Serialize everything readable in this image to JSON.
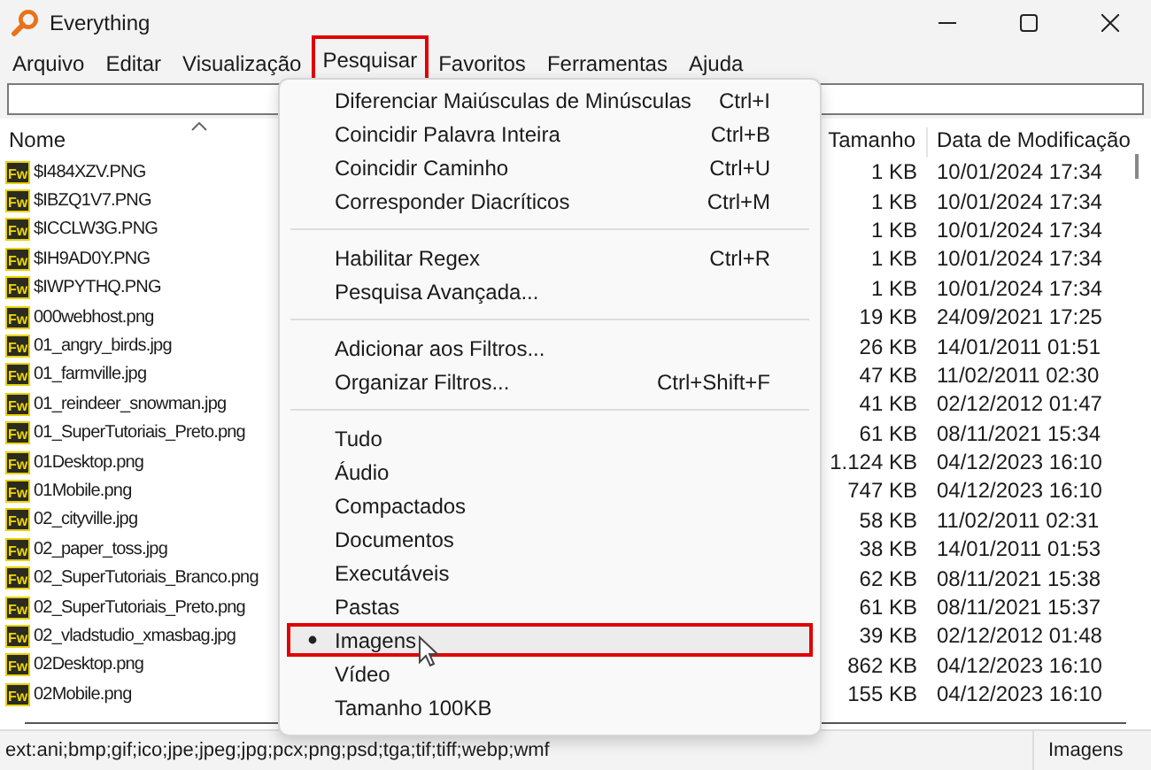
{
  "window": {
    "title": "Everything"
  },
  "menubar": [
    {
      "label": "Arquivo",
      "highlighted": false
    },
    {
      "label": "Editar",
      "highlighted": false
    },
    {
      "label": "Visualização",
      "highlighted": false
    },
    {
      "label": "Pesquisar",
      "highlighted": true
    },
    {
      "label": "Favoritos",
      "highlighted": false
    },
    {
      "label": "Ferramentas",
      "highlighted": false
    },
    {
      "label": "Ajuda",
      "highlighted": false
    }
  ],
  "search": {
    "kind": "empty"
  },
  "table": {
    "columns": [
      "Nome",
      "Tamanho",
      "Data de Modificação"
    ],
    "rows": [
      {
        "icon_text": "Fw",
        "name": "$I484XZV.PNG",
        "size": "1 KB",
        "date": "10/01/2024 17:34"
      },
      {
        "icon_text": "Fw",
        "name": "$IBZQ1V7.PNG",
        "size": "1 KB",
        "date": "10/01/2024 17:34"
      },
      {
        "icon_text": "Fw",
        "name": "$ICCLW3G.PNG",
        "size": "1 KB",
        "date": "10/01/2024 17:34"
      },
      {
        "icon_text": "Fw",
        "name": "$IH9AD0Y.PNG",
        "size": "1 KB",
        "date": "10/01/2024 17:34"
      },
      {
        "icon_text": "Fw",
        "name": "$IWPYTHQ.PNG",
        "size": "1 KB",
        "date": "10/01/2024 17:34"
      },
      {
        "icon_text": "Fw",
        "name": "000webhost.png",
        "size": "19 KB",
        "date": "24/09/2021 17:25"
      },
      {
        "icon_text": "Fw",
        "name": "01_angry_birds.jpg",
        "size": "26 KB",
        "date": "14/01/2011 01:51"
      },
      {
        "icon_text": "Fw",
        "name": "01_farmville.jpg",
        "size": "47 KB",
        "date": "11/02/2011 02:30"
      },
      {
        "icon_text": "Fw",
        "name": "01_reindeer_snowman.jpg",
        "size": "41 KB",
        "date": "02/12/2012 01:47"
      },
      {
        "icon_text": "Fw",
        "name": "01_SuperTutoriais_Preto.png",
        "size": "61 KB",
        "date": "08/11/2021 15:34"
      },
      {
        "icon_text": "Fw",
        "name": "01Desktop.png",
        "size": "1.124 KB",
        "date": "04/12/2023 16:10"
      },
      {
        "icon_text": "Fw",
        "name": "01Mobile.png",
        "size": "747 KB",
        "date": "04/12/2023 16:10"
      },
      {
        "icon_text": "Fw",
        "name": "02_cityville.jpg",
        "size": "58 KB",
        "date": "11/02/2011 02:31"
      },
      {
        "icon_text": "Fw",
        "name": "02_paper_toss.jpg",
        "size": "38 KB",
        "date": "14/01/2011 01:53"
      },
      {
        "icon_text": "Fw",
        "name": "02_SuperTutoriais_Branco.png",
        "size": "62 KB",
        "date": "08/11/2021 15:38"
      },
      {
        "icon_text": "Fw",
        "name": "02_SuperTutoriais_Preto.png",
        "size": "61 KB",
        "date": "08/11/2021 15:37"
      },
      {
        "icon_text": "Fw",
        "name": "02_vladstudio_xmasbag.jpg",
        "size": "39 KB",
        "date": "02/12/2012 01:48"
      },
      {
        "icon_text": "Fw",
        "name": "02Desktop.png",
        "size": "862 KB",
        "date": "04/12/2023 16:10"
      },
      {
        "icon_text": "Fw",
        "name": "02Mobile.png",
        "size": "155 KB",
        "date": "04/12/2023 16:10"
      }
    ]
  },
  "menu": {
    "groups": [
      [
        {
          "label": "Diferenciar Maiúsculas de Minúsculas",
          "shortcut": "Ctrl+I",
          "checked": false,
          "hovered": false,
          "highlighted": false
        },
        {
          "label": "Coincidir Palavra Inteira",
          "shortcut": "Ctrl+B",
          "checked": false,
          "hovered": false,
          "highlighted": false
        },
        {
          "label": "Coincidir Caminho",
          "shortcut": "Ctrl+U",
          "checked": false,
          "hovered": false,
          "highlighted": false
        },
        {
          "label": "Corresponder Diacríticos",
          "shortcut": "Ctrl+M",
          "checked": false,
          "hovered": false,
          "highlighted": false
        }
      ],
      [
        {
          "label": "Habilitar Regex",
          "shortcut": "Ctrl+R",
          "checked": false,
          "hovered": false,
          "highlighted": false
        },
        {
          "label": "Pesquisa Avançada...",
          "checked": false,
          "hovered": false,
          "highlighted": false
        }
      ],
      [
        {
          "label": "Adicionar aos Filtros...",
          "checked": false,
          "hovered": false,
          "highlighted": false
        },
        {
          "label": "Organizar Filtros...",
          "shortcut": "Ctrl+Shift+F",
          "checked": false,
          "hovered": false,
          "highlighted": false
        }
      ],
      [
        {
          "label": "Tudo",
          "checked": false,
          "hovered": false,
          "highlighted": false
        },
        {
          "label": "Áudio",
          "checked": false,
          "hovered": false,
          "highlighted": false
        },
        {
          "label": "Compactados",
          "checked": false,
          "hovered": false,
          "highlighted": false
        },
        {
          "label": "Documentos",
          "checked": false,
          "hovered": false,
          "highlighted": false
        },
        {
          "label": "Executáveis",
          "checked": false,
          "hovered": false,
          "highlighted": false
        },
        {
          "label": "Pastas",
          "checked": false,
          "hovered": false,
          "highlighted": false
        },
        {
          "label": "Imagens",
          "checked": true,
          "hovered": true,
          "highlighted": true
        },
        {
          "label": "Vídeo",
          "checked": false,
          "hovered": false,
          "highlighted": false
        },
        {
          "label": "Tamanho 100KB",
          "checked": false,
          "hovered": false,
          "highlighted": false
        }
      ]
    ]
  },
  "status_bar": {
    "filter": "ext:ani;bmp;gif;ico;jpe;jpeg;jpg;pcx;png;psd;tga;tif;tiff;webp;wmf",
    "active_filter": "Imagens"
  }
}
